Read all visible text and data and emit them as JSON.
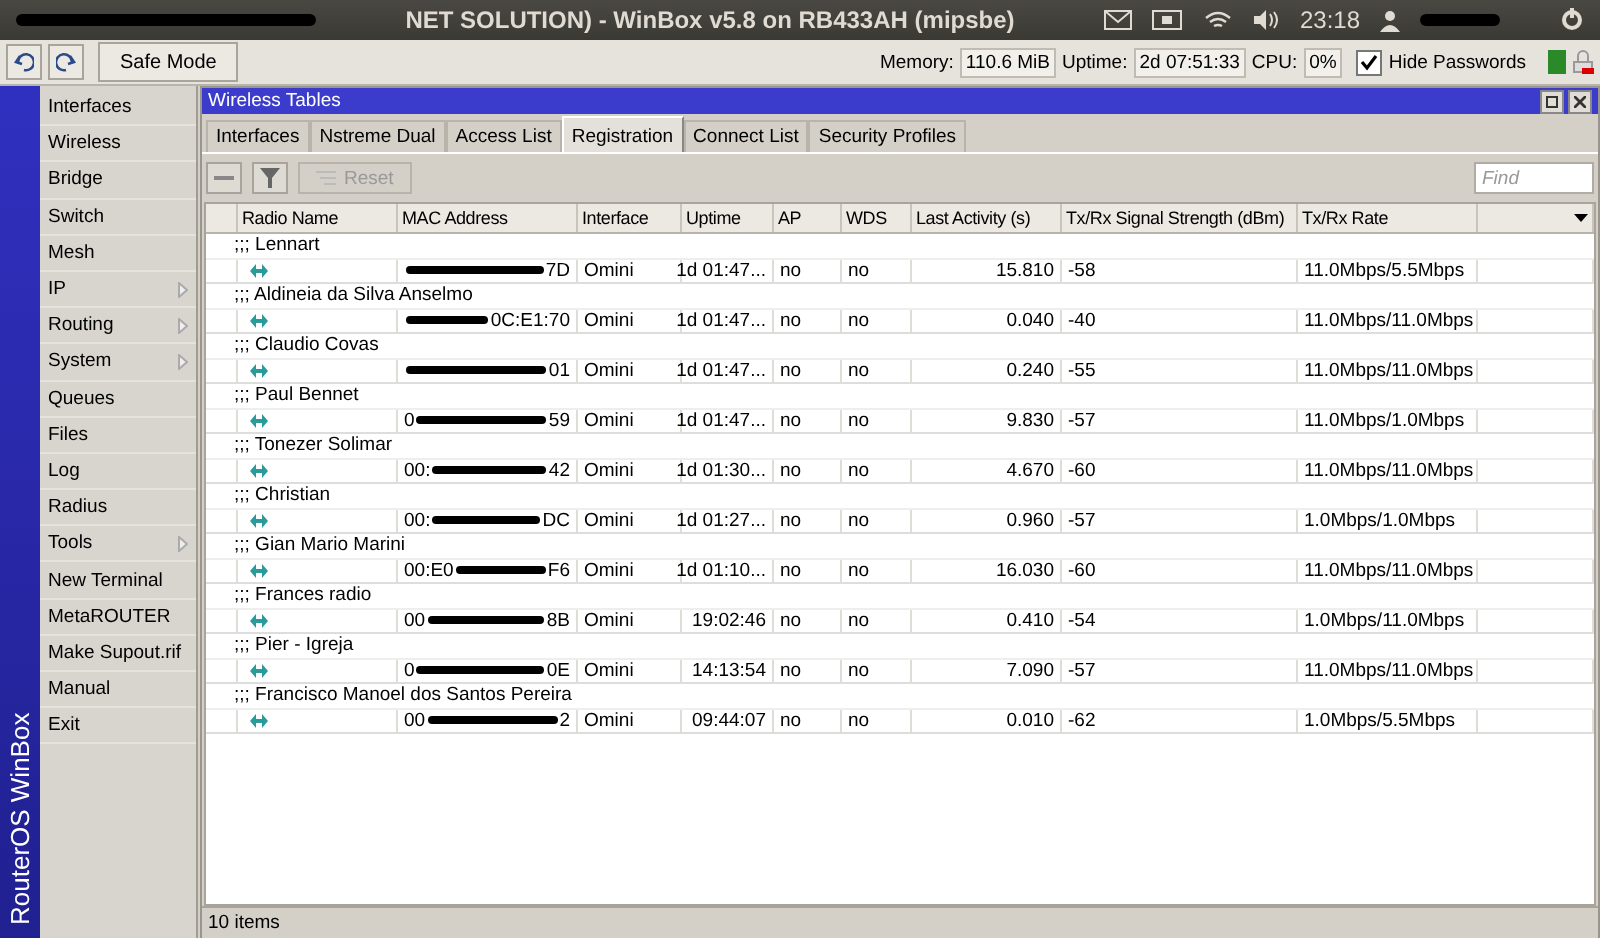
{
  "panel": {
    "title": "NET SOLUTION) - WinBox v5.8 on RB433AH (mipsbe)",
    "time": "23:18"
  },
  "toolbar": {
    "safe_mode": "Safe Mode",
    "memory_label": "Memory:",
    "memory": "110.6 MiB",
    "uptime_label": "Uptime:",
    "uptime": "2d 07:51:33",
    "cpu_label": "CPU:",
    "cpu": "0%",
    "hide_passwords": {
      "label": "Hide Passwords",
      "checked": true
    }
  },
  "sidebar": {
    "brand": "RouterOS WinBox",
    "items": [
      {
        "label": "Interfaces",
        "submenu": false
      },
      {
        "label": "Wireless",
        "submenu": false
      },
      {
        "label": "Bridge",
        "submenu": false
      },
      {
        "label": "Switch",
        "submenu": false
      },
      {
        "label": "Mesh",
        "submenu": false
      },
      {
        "label": "IP",
        "submenu": true
      },
      {
        "label": "Routing",
        "submenu": true
      },
      {
        "label": "System",
        "submenu": true
      },
      {
        "label": "Queues",
        "submenu": false
      },
      {
        "label": "Files",
        "submenu": false
      },
      {
        "label": "Log",
        "submenu": false
      },
      {
        "label": "Radius",
        "submenu": false
      },
      {
        "label": "Tools",
        "submenu": true
      },
      {
        "label": "New Terminal",
        "submenu": false
      },
      {
        "label": "MetaROUTER",
        "submenu": false
      },
      {
        "label": "Make Supout.rif",
        "submenu": false
      },
      {
        "label": "Manual",
        "submenu": false
      },
      {
        "label": "Exit",
        "submenu": false
      }
    ]
  },
  "window": {
    "title": "Wireless Tables",
    "tabs": [
      {
        "label": "Interfaces",
        "selected": false
      },
      {
        "label": "Nstreme Dual",
        "selected": false
      },
      {
        "label": "Access List",
        "selected": false
      },
      {
        "label": "Registration",
        "selected": true
      },
      {
        "label": "Connect List",
        "selected": false
      },
      {
        "label": "Security Profiles",
        "selected": false
      }
    ],
    "reset_label": "Reset",
    "find_placeholder": "Find",
    "columns": [
      "Radio Name",
      "MAC Address",
      "Interface",
      "Uptime",
      "AP",
      "WDS",
      "Last Activity (s)",
      "Tx/Rx Signal Strength (dBm)",
      "Tx/Rx Rate"
    ],
    "rows": [
      {
        "comment": ";;; Lennart",
        "mac_start": "",
        "mac_end": "7D",
        "interface": "Omini",
        "uptime": "1d 01:47...",
        "ap": "no",
        "wds": "no",
        "last_activity": "15.810",
        "signal": "-58",
        "rate": "11.0Mbps/5.5Mbps"
      },
      {
        "comment": ";;; Aldineia da Silva Anselmo",
        "mac_start": "",
        "mac_end": "0C:E1:70",
        "interface": "Omini",
        "uptime": "1d 01:47...",
        "ap": "no",
        "wds": "no",
        "last_activity": "0.040",
        "signal": "-40",
        "rate": "11.0Mbps/11.0Mbps"
      },
      {
        "comment": ";;; Claudio Covas",
        "mac_start": "",
        "mac_end": "01",
        "interface": "Omini",
        "uptime": "1d 01:47...",
        "ap": "no",
        "wds": "no",
        "last_activity": "0.240",
        "signal": "-55",
        "rate": "11.0Mbps/11.0Mbps"
      },
      {
        "comment": ";;; Paul Bennet",
        "mac_start": "0",
        "mac_end": "59",
        "interface": "Omini",
        "uptime": "1d 01:47...",
        "ap": "no",
        "wds": "no",
        "last_activity": "9.830",
        "signal": "-57",
        "rate": "11.0Mbps/1.0Mbps"
      },
      {
        "comment": ";;; Tonezer Solimar",
        "mac_start": "00:",
        "mac_end": "42",
        "interface": "Omini",
        "uptime": "1d 01:30...",
        "ap": "no",
        "wds": "no",
        "last_activity": "4.670",
        "signal": "-60",
        "rate": "11.0Mbps/11.0Mbps"
      },
      {
        "comment": ";;; Christian",
        "mac_start": "00:",
        "mac_end": "DC",
        "interface": "Omini",
        "uptime": "1d 01:27...",
        "ap": "no",
        "wds": "no",
        "last_activity": "0.960",
        "signal": "-57",
        "rate": "1.0Mbps/1.0Mbps"
      },
      {
        "comment": ";;; Gian Mario Marini",
        "mac_start": "00:E0",
        "mac_end": "F6",
        "interface": "Omini",
        "uptime": "1d 01:10...",
        "ap": "no",
        "wds": "no",
        "last_activity": "16.030",
        "signal": "-60",
        "rate": "11.0Mbps/11.0Mbps"
      },
      {
        "comment": ";;; Frances radio",
        "mac_start": "00",
        "mac_end": "8B",
        "interface": "Omini",
        "uptime": "19:02:46",
        "ap": "no",
        "wds": "no",
        "last_activity": "0.410",
        "signal": "-54",
        "rate": "1.0Mbps/11.0Mbps"
      },
      {
        "comment": ";;; Pier - Igreja",
        "mac_start": "0",
        "mac_end": "0E",
        "interface": "Omini",
        "uptime": "14:13:54",
        "ap": "no",
        "wds": "no",
        "last_activity": "7.090",
        "signal": "-57",
        "rate": "11.0Mbps/11.0Mbps"
      },
      {
        "comment": ";;; Francisco Manoel dos Santos Pereira",
        "mac_start": "00",
        "mac_end": "2",
        "interface": "Omini",
        "uptime": "09:44:07",
        "ap": "no",
        "wds": "no",
        "last_activity": "0.010",
        "signal": "-62",
        "rate": "1.0Mbps/5.5Mbps"
      }
    ],
    "status": "10 items"
  }
}
